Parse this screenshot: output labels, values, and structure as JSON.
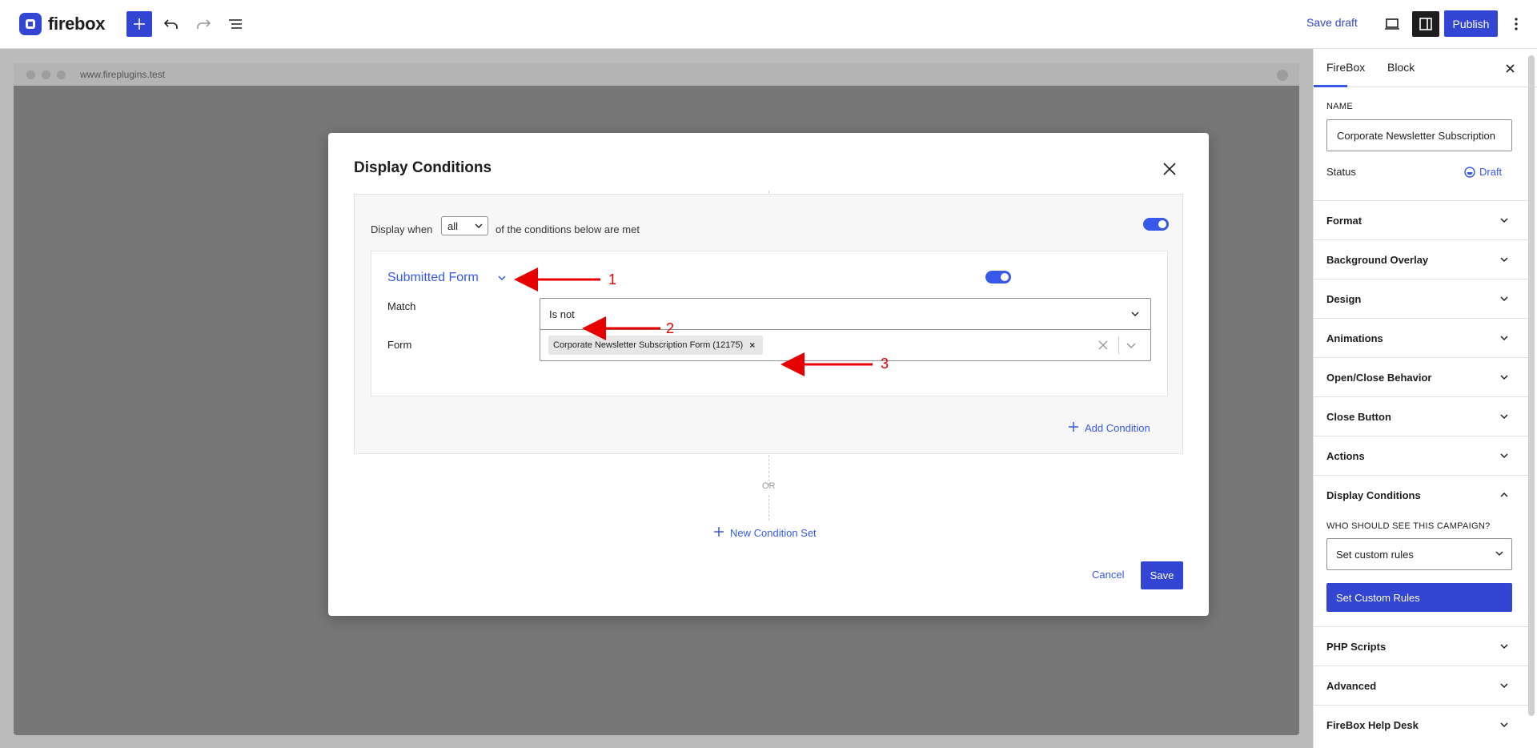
{
  "toolbar": {
    "logo_text": "firebox",
    "save_draft_label": "Save draft",
    "publish_label": "Publish"
  },
  "canvas": {
    "url": "www.fireplugins.test"
  },
  "modal": {
    "title": "Display Conditions",
    "display_when_label": "Display when",
    "match_select_value": "all",
    "display_when_suffix": "of the conditions below are met",
    "condition": {
      "title": "Submitted Form",
      "match_label": "Match",
      "match_value": "Is not",
      "form_label": "Form",
      "form_chip": "Corporate Newsletter Subscription Form (12175)"
    },
    "add_condition_label": "Add Condition",
    "or_label": "OR",
    "new_condition_set_label": "New Condition Set",
    "cancel_label": "Cancel",
    "save_label": "Save"
  },
  "annotations": [
    "1",
    "2",
    "3"
  ],
  "sidebar": {
    "tabs": [
      "FireBox",
      "Block"
    ],
    "name_label": "NAME",
    "name_value": "Corporate Newsletter Subscription",
    "status_label": "Status",
    "status_value": "Draft",
    "panels_top": [
      "Format",
      "Background Overlay",
      "Design",
      "Animations",
      "Open/Close Behavior",
      "Close Button",
      "Actions",
      "Display Conditions"
    ],
    "who_label": "WHO SHOULD SEE THIS CAMPAIGN?",
    "rules_select_value": "Set custom rules",
    "custom_rules_button": "Set Custom Rules",
    "panels_bottom": [
      "PHP Scripts",
      "Advanced",
      "FireBox Help Desk"
    ]
  },
  "colors": {
    "accent": "#3346d3",
    "link": "#3858e9",
    "annotation": "#e60000"
  },
  "icons": {
    "add": "plus-icon",
    "undo": "undo-icon",
    "redo": "redo-icon",
    "list_view": "list-view-icon",
    "desktop_view": "desktop-icon",
    "settings": "sidebar-settings-icon",
    "more": "more-vertical-icon"
  }
}
